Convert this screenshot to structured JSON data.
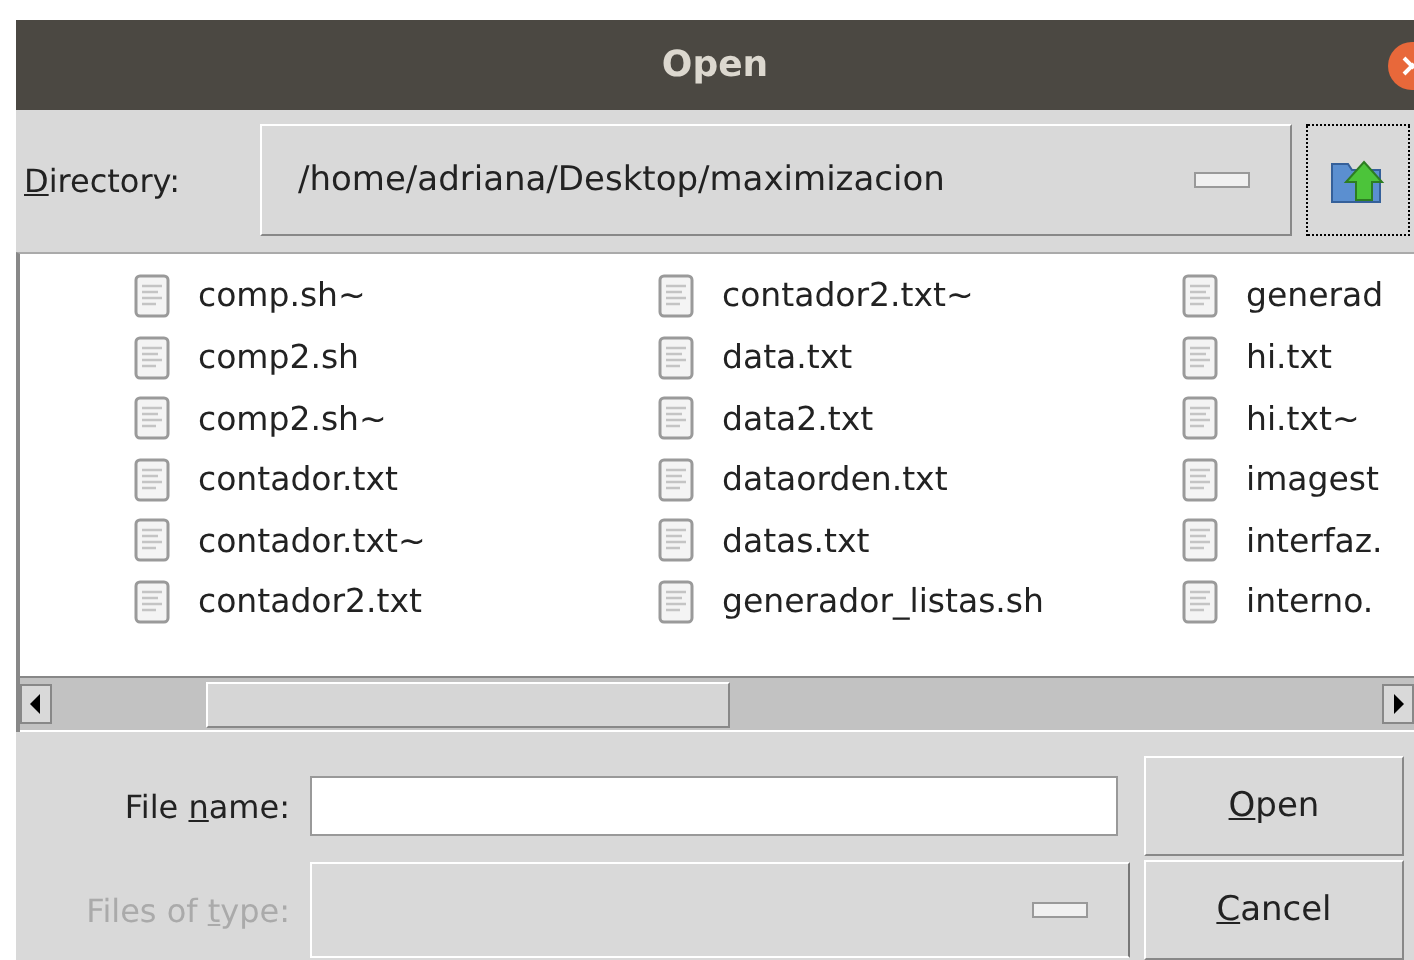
{
  "window": {
    "title": "Open"
  },
  "directory": {
    "label": {
      "key": "D",
      "after": "irectory:"
    },
    "value": "/home/adriana/Desktop/maximizacion"
  },
  "files": [
    [
      "comp.sh~",
      "comp2.sh",
      "comp2.sh~",
      "contador.txt",
      "contador.txt~",
      "contador2.txt"
    ],
    [
      "contador2.txt~",
      "data.txt",
      "data2.txt",
      "dataorden.txt",
      "datas.txt",
      "generador_listas.sh"
    ],
    [
      "generad",
      "hi.txt",
      "hi.txt~",
      "imagest",
      "interfaz.",
      "interno."
    ]
  ],
  "file_name": {
    "label": {
      "before": "File ",
      "key": "n",
      "after": "ame:"
    },
    "disabled": false
  },
  "files_of_type": {
    "label": {
      "before": "Files of ",
      "key": "t",
      "after": "ype:"
    },
    "disabled": true
  },
  "buttons": [
    {
      "label": {
        "key": "O",
        "after": "pen"
      }
    },
    {
      "label": {
        "key": "C",
        "after": "ancel"
      }
    }
  ]
}
